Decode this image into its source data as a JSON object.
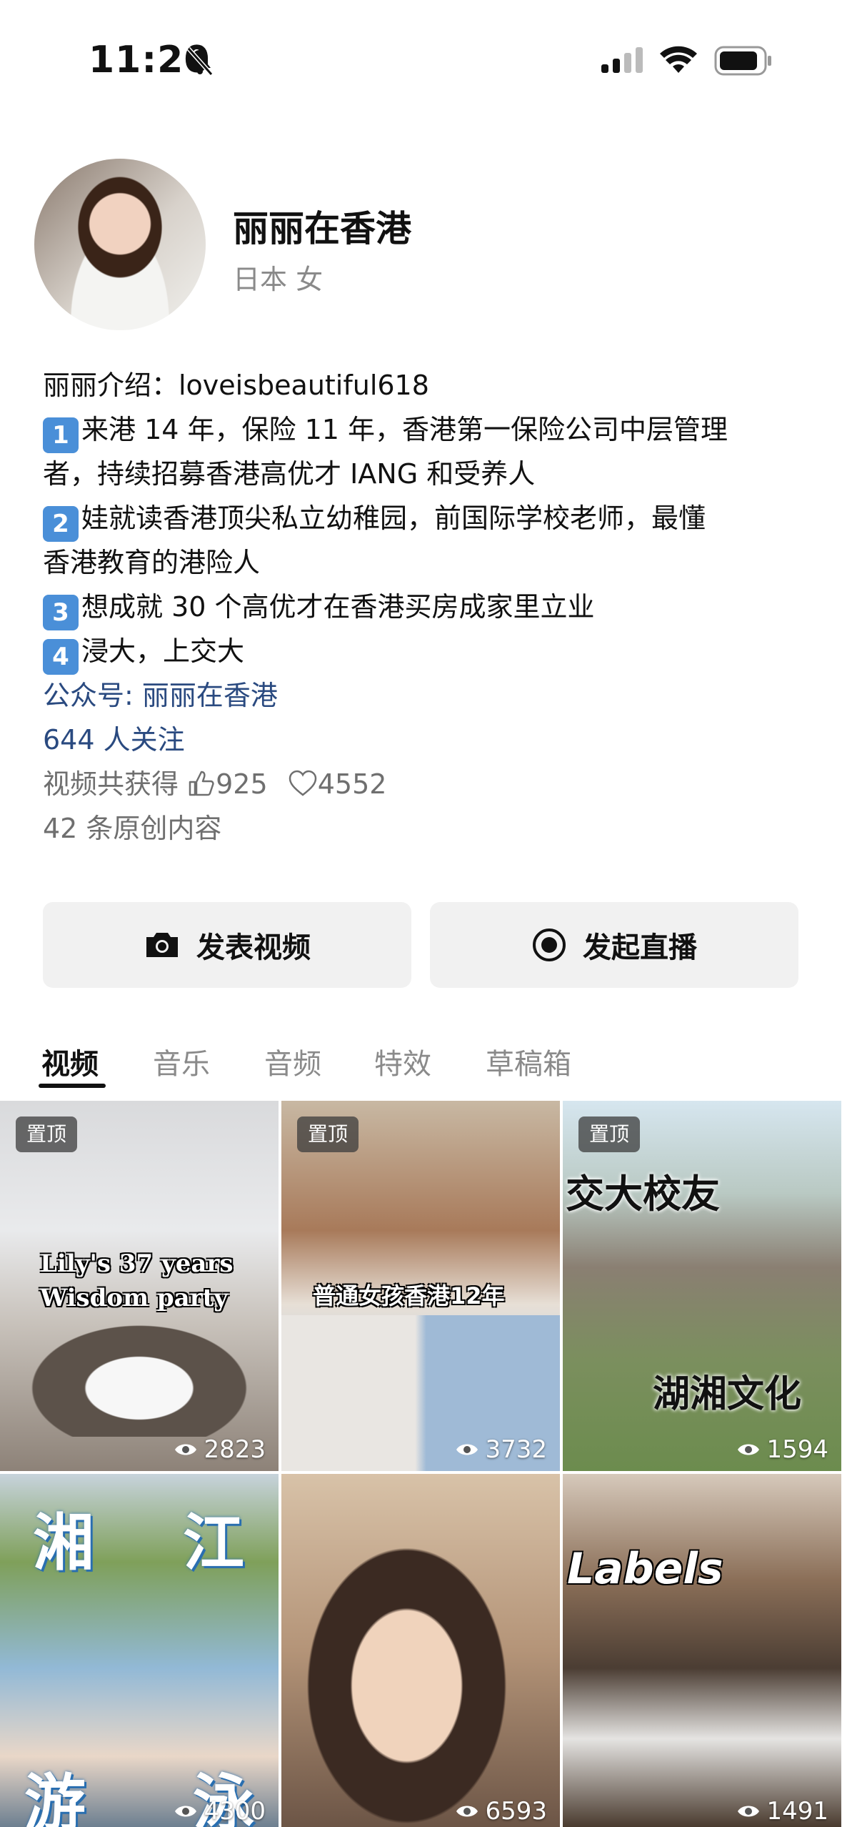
{
  "status_bar": {
    "time": "11:20"
  },
  "profile": {
    "name": "丽丽在香港",
    "subline": "日本  女",
    "bio_intro": "丽丽介绍：loveisbeautiful618",
    "bio_items": [
      {
        "num": "1",
        "text": "来港 14 年，保险 11 年，香港第一保险公司中层管理"
      },
      {
        "num": "",
        "text": "者，持续招募香港高优才 IANG 和受养人"
      },
      {
        "num": "2",
        "text": "娃就读香港顶尖私立幼稚园，前国际学校老师，最懂"
      },
      {
        "num": "",
        "text": "香港教育的港险人"
      },
      {
        "num": "3",
        "text": "想成就 30 个高优才在香港买房成家里立业"
      },
      {
        "num": "4",
        "text": "浸大，上交大"
      }
    ],
    "official_account": "公众号: 丽丽在香港",
    "followers": "644 人关注",
    "likes_prefix": "视频共获得",
    "likes_count": "925",
    "hearts_count": "4552",
    "original_count": "42 条原创内容"
  },
  "actions": {
    "post_video": "发表视频",
    "go_live": "发起直播"
  },
  "tabs": [
    "视频",
    "音乐",
    "音频",
    "特效",
    "草稿箱"
  ],
  "videos": [
    {
      "pinned": "置顶",
      "caption_line1": "Lily's 37 years",
      "caption_line2": "Wisdom party",
      "views": "2823"
    },
    {
      "pinned": "置顶",
      "caption_line1": "普通女孩香港12年",
      "views": "3732"
    },
    {
      "pinned": "置顶",
      "caption_line1": "交大校友",
      "caption_line2": "湖湘文化",
      "views": "1594"
    },
    {
      "caption_line1": "湘",
      "caption_line2": "江",
      "caption_line3": "游",
      "caption_line4": "泳",
      "views": "4300"
    },
    {
      "views": "6593"
    },
    {
      "caption_line1": "Labels",
      "views": "1491"
    }
  ]
}
